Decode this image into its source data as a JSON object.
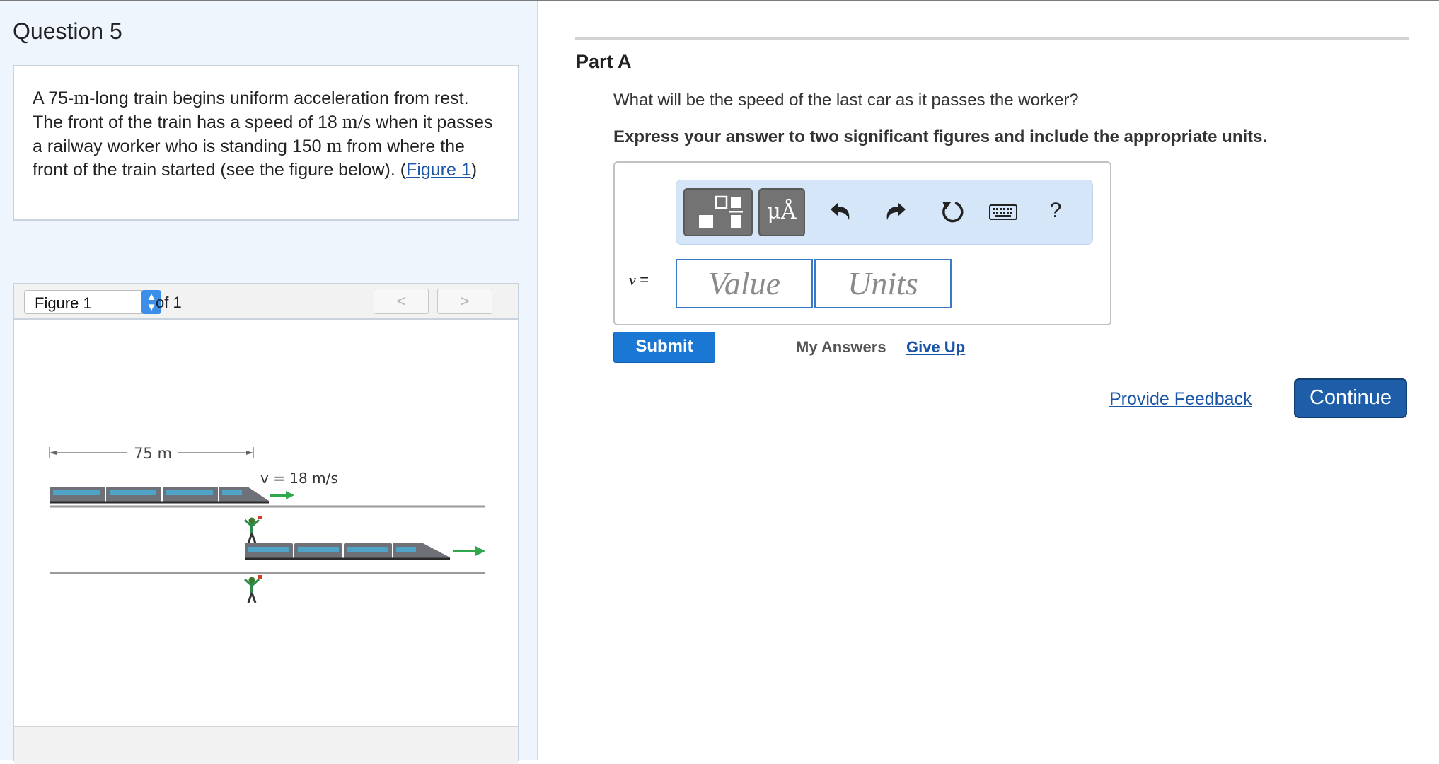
{
  "question": {
    "title": "Question 5",
    "problem": {
      "t1": "A 75-",
      "m1": "m",
      "t2": "-long train begins uniform acceleration from rest. The front of the train has a speed of 18 ",
      "m2": "m/s",
      "t3": " when it passes a railway worker who is standing 150 ",
      "m3": "m",
      "t4": " from where the front of the train started (see the figure below). (",
      "link": "Figure 1",
      "t5": ")"
    }
  },
  "figure_panel": {
    "select_value": "Figure 1",
    "of_label": "of 1",
    "prev_label": "<",
    "next_label": ">",
    "figure": {
      "distance_label": "75 m",
      "velocity_label": "v = 18 m/s"
    }
  },
  "part": {
    "title": "Part A",
    "question": "What will be the speed of the last car as it passes the worker?",
    "instruction": "Express your answer to two significant figures and include the appropriate units.",
    "toolbar": {
      "icons": [
        "template-icon",
        "units-icon",
        "undo-icon",
        "redo-icon",
        "reset-icon",
        "keyboard-icon",
        "help-icon"
      ],
      "units_label": "μÅ",
      "help_label": "?"
    },
    "variable": "v",
    "equals": "=",
    "value_placeholder": "Value",
    "units_placeholder": "Units",
    "submit_label": "Submit",
    "my_answers_label": "My Answers",
    "give_up_label": "Give Up"
  },
  "footer": {
    "feedback_label": "Provide Feedback",
    "continue_label": "Continue"
  },
  "colors": {
    "link": "#1a55a8",
    "submit": "#1a78d4",
    "continue": "#1e5ea8",
    "left_pane_bg": "#eef5fd"
  }
}
